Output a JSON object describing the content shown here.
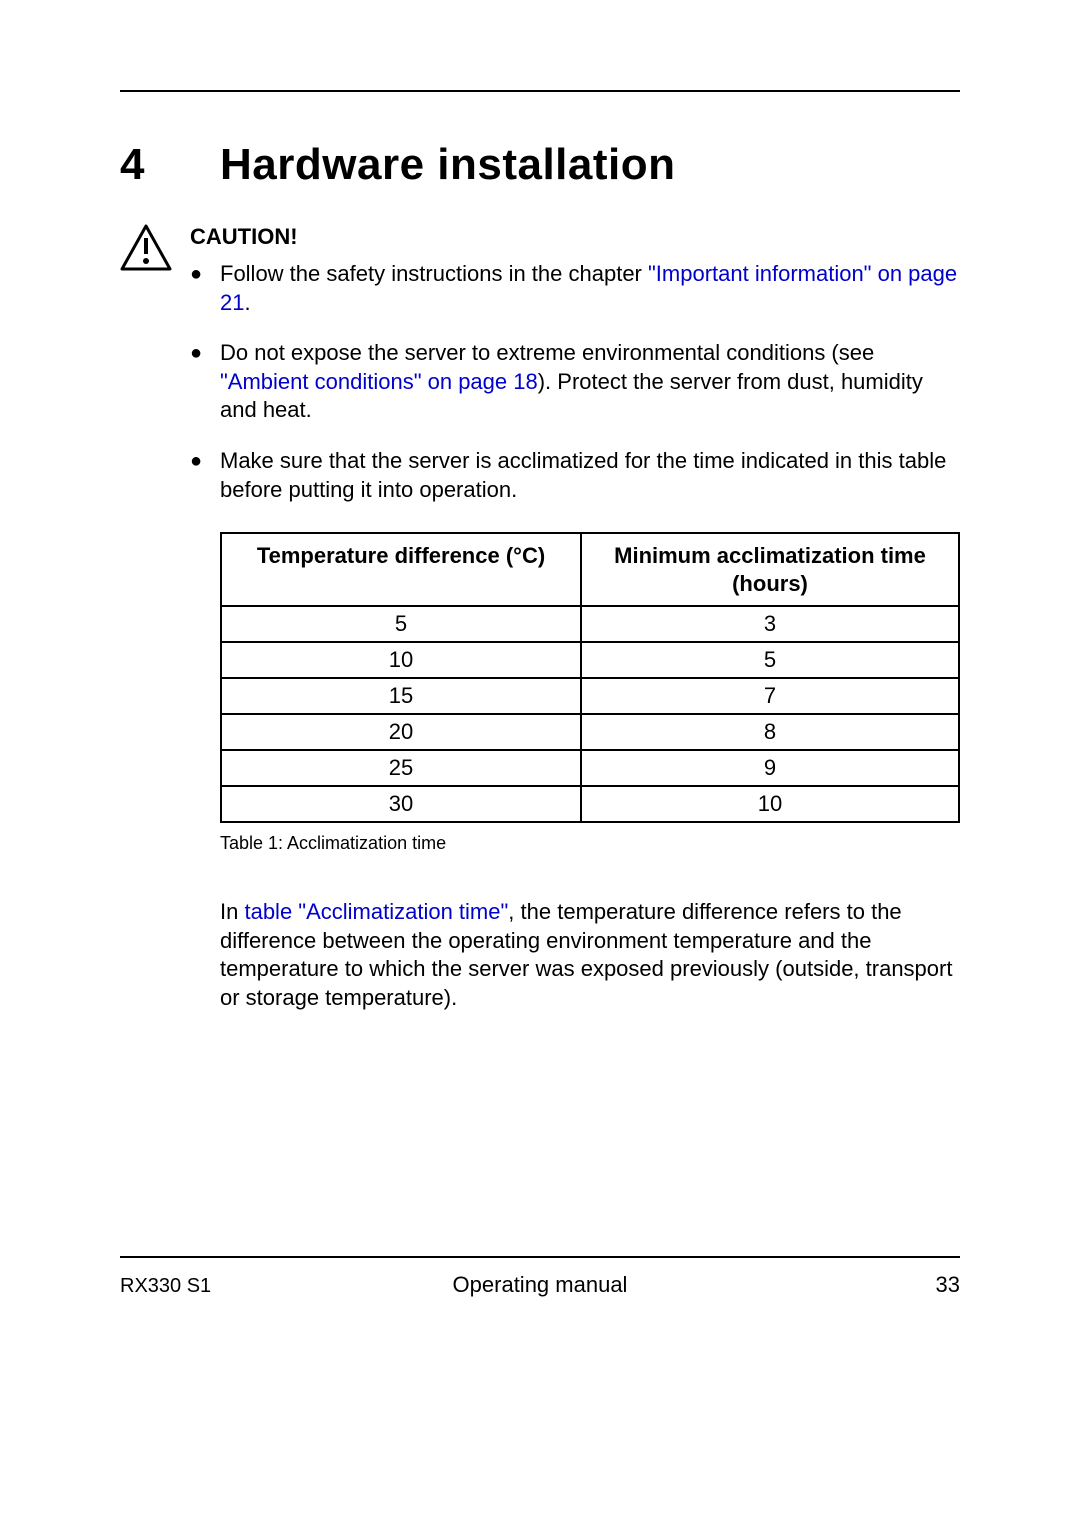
{
  "chapter": {
    "number": "4",
    "title": "Hardware installation"
  },
  "caution": {
    "label": "CAUTION!",
    "bullets": [
      {
        "pre": "Follow the safety instructions in the chapter ",
        "link": "\"Important information\" on page 21",
        "post": "."
      },
      {
        "pre": "Do not expose the server to extreme environmental conditions (see ",
        "link": "\"Ambient conditions\" on page 18",
        "post": "). Protect the server from dust, humidity and heat."
      },
      {
        "pre": "Make sure that the server is acclimatized for the time indicated in this table before putting it into operation.",
        "link": "",
        "post": ""
      }
    ]
  },
  "table": {
    "header1": "Temperature difference (°C)",
    "header2": "Minimum acclimatization time (hours)",
    "rows": [
      {
        "c1": "5",
        "c2": "3"
      },
      {
        "c1": "10",
        "c2": "5"
      },
      {
        "c1": "15",
        "c2": "7"
      },
      {
        "c1": "20",
        "c2": "8"
      },
      {
        "c1": "25",
        "c2": "9"
      },
      {
        "c1": "30",
        "c2": "10"
      }
    ],
    "caption": "Table 1: Acclimatization time"
  },
  "para_after": {
    "pre": "In ",
    "link": "table \"Acclimatization time\"",
    "post": ", the temperature difference refers to the difference between the operating environment temperature and the temperature to which the server was exposed previously (outside, transport or storage temperature)."
  },
  "footer": {
    "left": "RX330 S1",
    "center": "Operating manual",
    "right": "33"
  },
  "chart_data": {
    "type": "table",
    "title": "Acclimatization time",
    "columns": [
      "Temperature difference (°C)",
      "Minimum acclimatization time (hours)"
    ],
    "rows": [
      [
        5,
        3
      ],
      [
        10,
        5
      ],
      [
        15,
        7
      ],
      [
        20,
        8
      ],
      [
        25,
        9
      ],
      [
        30,
        10
      ]
    ]
  }
}
